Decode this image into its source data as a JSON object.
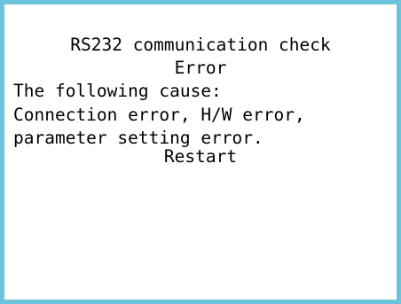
{
  "dialog": {
    "title": "RS232 communication check",
    "status": "Error",
    "cause_heading": "The following cause:",
    "cause_line_1": "Connection error, H/W error,",
    "cause_line_2": "parameter setting error.",
    "restart_label": "Restart"
  },
  "colors": {
    "frame_border": "#6cc3dc",
    "background": "#ffffff",
    "text": "#000000"
  }
}
